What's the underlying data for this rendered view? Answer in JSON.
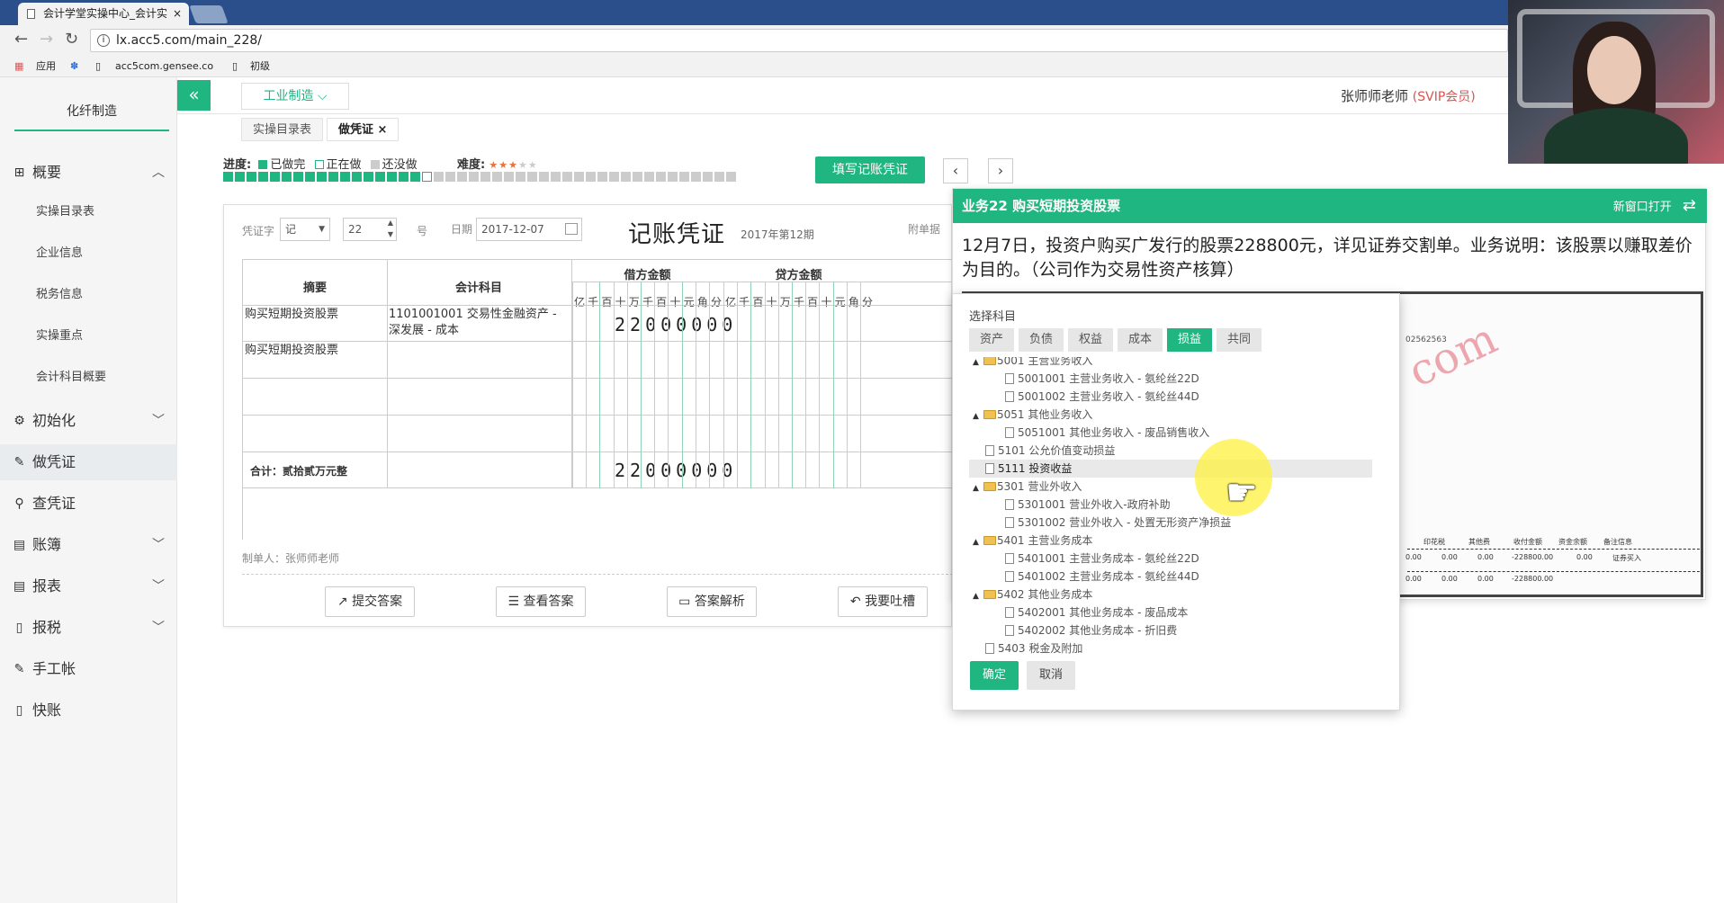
{
  "browser": {
    "tab_title": "会计学堂实操中心_会计实",
    "tab_close": "×",
    "url": "lx.acc5.com/main_228/",
    "bookmarks": [
      "应用",
      "acc5com.gensee.co",
      "初级"
    ]
  },
  "sidebar": {
    "title": "化纤制造",
    "items": [
      {
        "label": "概要",
        "icon": "grid-icon",
        "expanded": true
      },
      {
        "label": "初始化",
        "icon": "gear-icon"
      },
      {
        "label": "做凭证",
        "icon": "pencil-icon"
      },
      {
        "label": "查凭证",
        "icon": "search-icon"
      },
      {
        "label": "账簿",
        "icon": "book-icon"
      },
      {
        "label": "报表",
        "icon": "table-icon"
      },
      {
        "label": "报税",
        "icon": "file-icon"
      },
      {
        "label": "手工帐",
        "icon": "pencil-icon"
      },
      {
        "label": "快账",
        "icon": "file-icon"
      }
    ],
    "sub_items": [
      "实操目录表",
      "企业信息",
      "税务信息",
      "实操重点",
      "会计科目概要"
    ]
  },
  "header": {
    "collapse": "«",
    "industry": "工业制造 ⌵",
    "user": "张师师老师",
    "user_badge": "(SVIP会员)",
    "tabs": [
      "实操目录表",
      "做凭证"
    ],
    "tab_close": "×"
  },
  "progress": {
    "label": "进度:",
    "done": "已做完",
    "doing": "正在做",
    "todo": "还没做",
    "difficulty": "难度:",
    "done_count": 17,
    "current_index": 18,
    "total": 44,
    "difficulty_stars": 3,
    "fill_button": "填写记账凭证",
    "prev": "‹",
    "next": "›"
  },
  "voucher": {
    "type_label": "凭证字",
    "type_value": "记",
    "number_value": "22",
    "number_suffix": "号",
    "date_label": "日期",
    "date_value": "2017-12-07",
    "title": "记账凭证",
    "period": "2017年第12期",
    "attach_label": "附单据",
    "col_summary": "摘要",
    "col_account": "会计科目",
    "col_debit": "借方金额",
    "col_credit": "贷方金额",
    "digit_headers": [
      "亿",
      "千",
      "百",
      "十",
      "万",
      "千",
      "百",
      "十",
      "元",
      "角",
      "分"
    ],
    "rows": [
      {
        "summary": "购买短期投资股票",
        "account": "1101001001 交易性金融资产 - 深发展 - 成本",
        "debit": "22000000"
      },
      {
        "summary": "购买短期投资股票",
        "account": "",
        "debit": ""
      },
      {
        "summary": "",
        "account": "",
        "debit": ""
      },
      {
        "summary": "",
        "account": "",
        "debit": ""
      }
    ],
    "total_label": "合计：贰拾贰万元整",
    "total_debit": "22000000",
    "maker": "制单人：张师师老师",
    "actions": [
      "提交答案",
      "查看答案",
      "答案解析",
      "我要吐槽"
    ]
  },
  "task": {
    "title": "业务22 购买短期投资股票",
    "open_new": "新窗口打开",
    "description": "12月7日，投资户购买广发行的股票228800元，详见证券交割单。业务说明：该股票以赚取差价为目的。（公司作为交易性资产核算）",
    "img_code": "02562563",
    "img_watermark": "com",
    "img_headers": [
      "印花税",
      "其他费",
      "收付金额",
      "资金余额",
      "备注信息"
    ],
    "img_values": [
      "0.00",
      "0.00",
      "0.00",
      "-228800.00",
      "0.00",
      "证券买入"
    ],
    "img_values2": [
      "0.00",
      "0.00",
      "0.00",
      "-228800.00"
    ]
  },
  "picker": {
    "title": "选择科目",
    "tabs": [
      "资产",
      "负债",
      "权益",
      "成本",
      "损益",
      "共同"
    ],
    "active_tab": "损益",
    "rows": [
      {
        "text": "5001 主营业务收入",
        "kind": "folder"
      },
      {
        "text": "5001001 主营业务收入 - 氨纶丝22D",
        "kind": "leaf"
      },
      {
        "text": "5001002 主营业务收入 - 氨纶丝44D",
        "kind": "leaf"
      },
      {
        "text": "5051 其他业务收入",
        "kind": "folder"
      },
      {
        "text": "5051001 其他业务收入 - 废品销售收入",
        "kind": "leaf"
      },
      {
        "text": "5101 公允价值变动损益",
        "kind": "top"
      },
      {
        "text": "5111 投资收益",
        "kind": "top"
      },
      {
        "text": "5301 营业外收入",
        "kind": "folder"
      },
      {
        "text": "5301001 营业外收入-政府补助",
        "kind": "leaf"
      },
      {
        "text": "5301002 营业外收入 - 处置无形资产净损益",
        "kind": "leaf"
      },
      {
        "text": "5401 主营业务成本",
        "kind": "folder"
      },
      {
        "text": "5401001 主营业务成本 - 氨纶丝22D",
        "kind": "leaf"
      },
      {
        "text": "5401002 主营业务成本 - 氨纶丝44D",
        "kind": "leaf"
      },
      {
        "text": "5402 其他业务成本",
        "kind": "folder"
      },
      {
        "text": "5402001 其他业务成本 - 废品成本",
        "kind": "leaf"
      },
      {
        "text": "5402002 其他业务成本 - 折旧费",
        "kind": "leaf"
      },
      {
        "text": "5403 税金及附加",
        "kind": "top"
      }
    ],
    "selected_index": 6,
    "confirm": "确定",
    "cancel": "取消"
  },
  "colors": {
    "accent": "#1fb681",
    "svip": "#d9534f"
  }
}
